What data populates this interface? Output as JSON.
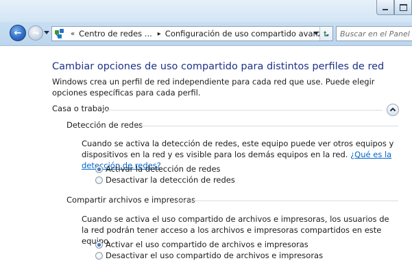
{
  "navigation": {
    "breadcrumb_prefix": "«",
    "breadcrumb": [
      "Centro de redes ...",
      "Configuración de uso compartido avanzado"
    ],
    "breadcrumb_separator": "▸",
    "search_placeholder": "Buscar en el Panel de control"
  },
  "page": {
    "title": "Cambiar opciones de uso compartido para distintos perfiles de red",
    "description": "Windows crea un perfil de red independiente para cada red que use. Puede elegir opciones específicas para cada perfil."
  },
  "profile": {
    "label": "Casa o trabajo",
    "expanded": true
  },
  "sections": {
    "network_discovery": {
      "title": "Detección de redes",
      "description": "Cuando se activa la detección de redes, este equipo puede ver otros equipos y dispositivos en la red y es visible para los demás equipos en la red.",
      "help_link": "¿Qué es la detección de redes?",
      "options": [
        {
          "label": "Activar la detección de redes",
          "checked": true
        },
        {
          "label": "Desactivar la detección de redes",
          "checked": false
        }
      ]
    },
    "file_printer_sharing": {
      "title": "Compartir archivos e impresoras",
      "description": "Cuando se activa el uso compartido de archivos e impresoras, los usuarios de la red podrán tener acceso a los archivos e impresoras compartidos en este equipo.",
      "options": [
        {
          "label": "Activar el uso compartido de archivos e impresoras",
          "checked": true
        },
        {
          "label": "Desactivar el uso compartido de archivos e impresoras",
          "checked": false
        }
      ]
    }
  },
  "icons": {
    "back": "back-arrow-icon",
    "forward": "forward-arrow-icon",
    "control_panel": "control-panel-icon",
    "refresh": "refresh-icon",
    "collapse": "chevron-up-icon"
  },
  "colors": {
    "title_blue": "#1e3287",
    "link_blue": "#0066cc",
    "chrome_blue": "#c9dff2"
  }
}
